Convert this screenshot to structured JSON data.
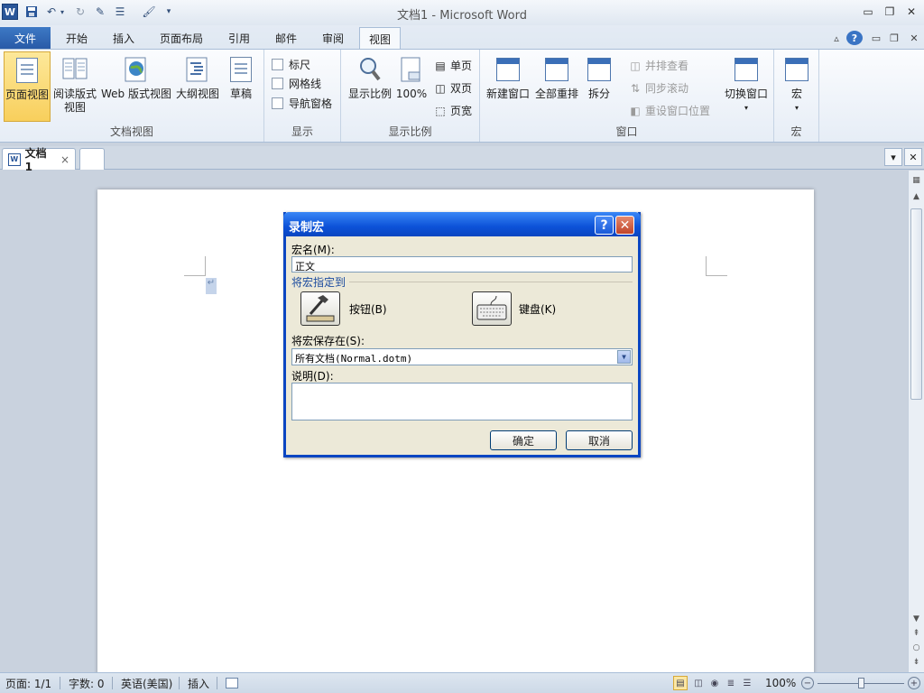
{
  "titlebar": {
    "title": "文档1  -  Microsoft Word",
    "app_icon": "W",
    "quick_access": [
      "save-icon",
      "undo-icon",
      "redo-icon",
      "edit-icon",
      "layout-icon",
      "format-painter-icon",
      "customize-icon"
    ]
  },
  "tabs": [
    "文件",
    "开始",
    "插入",
    "页面布局",
    "引用",
    "邮件",
    "审阅",
    "视图"
  ],
  "active_tab": "视图",
  "ribbon": {
    "doc_views": {
      "label": "文档视图",
      "items": [
        "页面视图",
        "阅读版式\n视图",
        "Web 版式视图",
        "大纲视图",
        "草稿"
      ]
    },
    "show": {
      "label": "显示",
      "items": [
        "标尺",
        "网格线",
        "导航窗格"
      ]
    },
    "zoom": {
      "label": "显示比例",
      "zoom": "显示比例",
      "percent": "100%",
      "one_page": "单页",
      "two_pages": "双页",
      "page_width": "页宽"
    },
    "window": {
      "label": "窗口",
      "new_window": "新建窗口",
      "arrange_all": "全部重排",
      "split": "拆分",
      "side_by_side": "并排查看",
      "sync_scroll": "同步滚动",
      "reset_pos": "重设窗口位置",
      "switch": "切换窗口"
    },
    "macros": {
      "label": "宏",
      "item": "宏"
    }
  },
  "doc_tab": {
    "name": "文档1",
    "close": "×"
  },
  "dialog": {
    "title": "录制宏",
    "help": "?",
    "close": "✕",
    "macro_name_label": "宏名(M):",
    "macro_name": "正文",
    "assign_label": "将宏指定到",
    "button_label": "按钮(B)",
    "keyboard_label": "键盘(K)",
    "store_label": "将宏保存在(S):",
    "store_value": "所有文档(Normal.dotm)",
    "desc_label": "说明(D):",
    "ok": "确定",
    "cancel": "取消"
  },
  "status": {
    "page": "页面: 1/1",
    "words": "字数: 0",
    "language": "英语(美国)",
    "mode": "插入",
    "zoom": "100%",
    "minus": "−",
    "plus": "+"
  }
}
